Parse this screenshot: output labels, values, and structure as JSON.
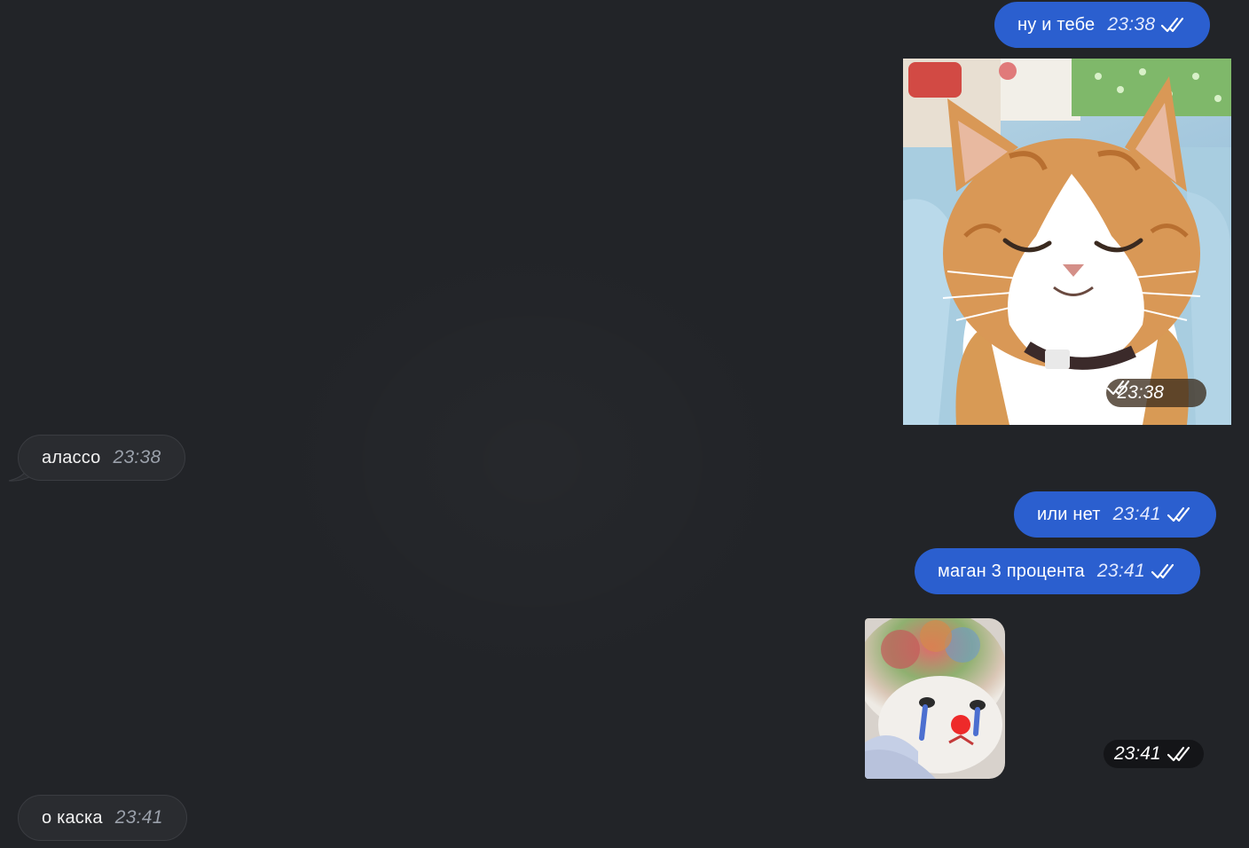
{
  "messages": [
    {
      "id": "m1",
      "direction": "outgoing",
      "type": "text",
      "text": "ну и тебе",
      "time": "23:38",
      "status": "read"
    },
    {
      "id": "m2",
      "direction": "outgoing",
      "type": "photo",
      "image": "smiling ginger cat",
      "time": "23:38",
      "status": "read"
    },
    {
      "id": "m3",
      "direction": "incoming",
      "type": "text",
      "text": "алассо",
      "time": "23:38"
    },
    {
      "id": "m4",
      "direction": "outgoing",
      "type": "text",
      "text": "или нет",
      "time": "23:41",
      "status": "read"
    },
    {
      "id": "m5",
      "direction": "outgoing",
      "type": "text",
      "text": "маган 3 процента",
      "time": "23:41",
      "status": "read"
    },
    {
      "id": "m6",
      "direction": "outgoing",
      "type": "sticker",
      "image": "crying clown cat sticker",
      "time": "23:41",
      "status": "read"
    },
    {
      "id": "m7",
      "direction": "incoming",
      "type": "text",
      "text": "о каска",
      "time": "23:41"
    }
  ],
  "icons": {
    "read_status": "double-check-icon"
  },
  "colors": {
    "background": "#222428",
    "outgoing_bubble": "#2b5fcf",
    "incoming_bubble": "#2a2c30",
    "incoming_border": "#3a3c41",
    "incoming_time": "#9aa0aa"
  }
}
